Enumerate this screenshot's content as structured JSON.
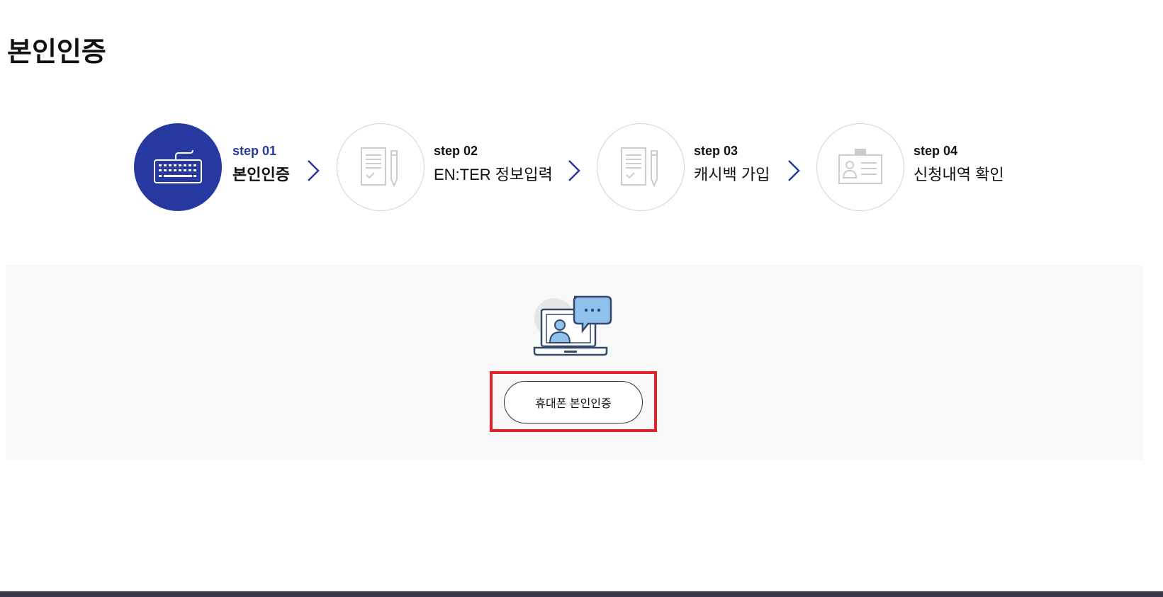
{
  "page": {
    "title": "본인인증"
  },
  "steps": [
    {
      "number": "step 01",
      "label": "본인인증",
      "icon": "keyboard-icon",
      "active": true
    },
    {
      "number": "step 02",
      "label": "EN:TER 정보입력",
      "icon": "document-pencil-icon",
      "active": false
    },
    {
      "number": "step 03",
      "label": "캐시백 가입",
      "icon": "document-pencil-icon",
      "active": false
    },
    {
      "number": "step 04",
      "label": "신청내역 확인",
      "icon": "id-card-icon",
      "active": false
    }
  ],
  "verification": {
    "icon": "laptop-chat-icon",
    "phone_button_label": "휴대폰 본인인증"
  },
  "colors": {
    "accent": "#2639a1",
    "highlight": "#e2222a",
    "panel_bg": "#f8f8f8",
    "footer": "#3b3a4a"
  }
}
